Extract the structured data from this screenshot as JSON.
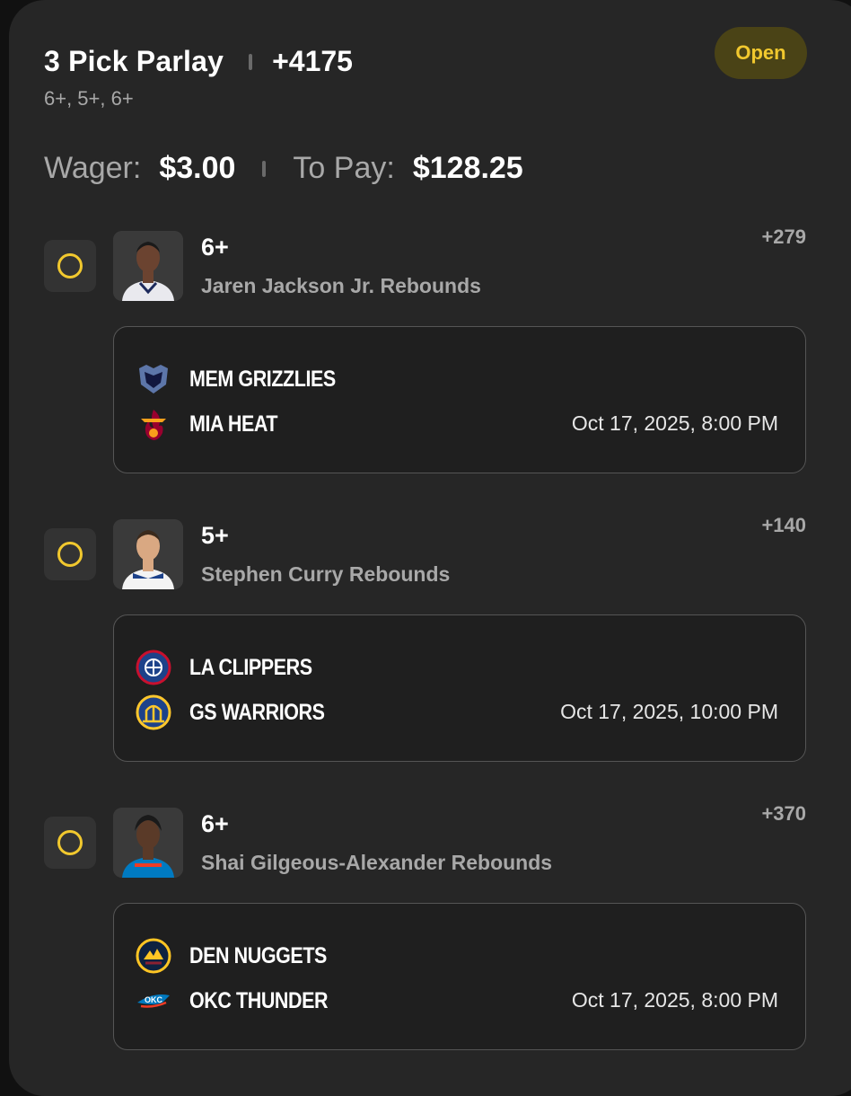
{
  "header": {
    "title": "3 Pick Parlay",
    "total_odds": "+4175",
    "lines_summary": "6+, 5+, 6+",
    "status": "Open"
  },
  "money": {
    "wager_label": "Wager:",
    "wager_value": "$3.00",
    "pay_label": "To Pay:",
    "pay_value": "$128.25"
  },
  "picks": [
    {
      "line": "6+",
      "market": "Jaren Jackson Jr. Rebounds",
      "odds": "+279",
      "avatar_icon": "player-headshot-icon",
      "game": {
        "team1": "MEM GRIZZLIES",
        "team1_icon": "grizzlies-logo-icon",
        "team2": "MIA HEAT",
        "team2_icon": "heat-logo-icon",
        "time": "Oct 17, 2025, 8:00 PM"
      }
    },
    {
      "line": "5+",
      "market": "Stephen Curry Rebounds",
      "odds": "+140",
      "avatar_icon": "player-headshot-icon",
      "game": {
        "team1": "LA CLIPPERS",
        "team1_icon": "clippers-logo-icon",
        "team2": "GS WARRIORS",
        "team2_icon": "warriors-logo-icon",
        "time": "Oct 17, 2025, 10:00 PM"
      }
    },
    {
      "line": "6+",
      "market": "Shai Gilgeous-Alexander Rebounds",
      "odds": "+370",
      "avatar_icon": "player-headshot-icon",
      "game": {
        "team1": "DEN NUGGETS",
        "team1_icon": "nuggets-logo-icon",
        "team2": "OKC THUNDER",
        "team2_icon": "thunder-logo-icon",
        "time": "Oct 17, 2025, 8:00 PM"
      }
    }
  ],
  "colors": {
    "background": "#111111",
    "card": "#262626",
    "accent": "#f1c82e",
    "muted_text": "#a8a8a8"
  }
}
